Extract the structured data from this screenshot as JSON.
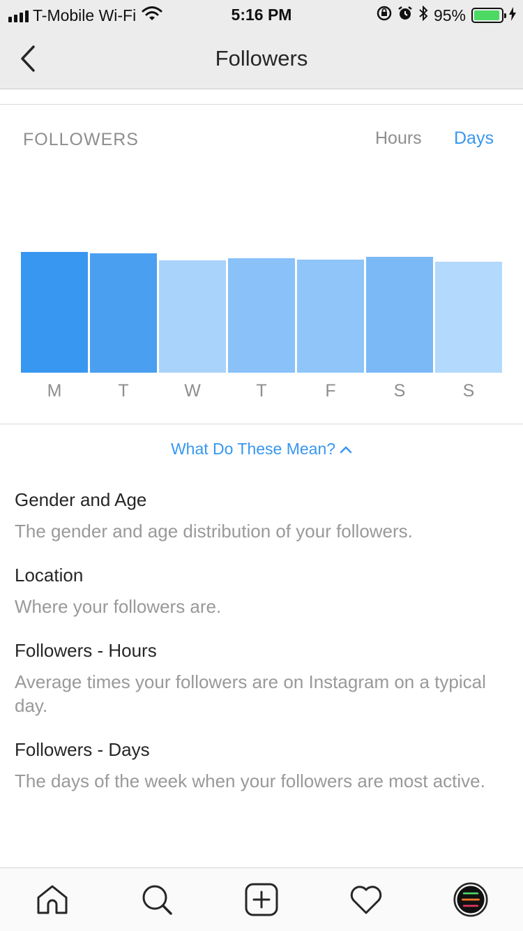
{
  "status_bar": {
    "carrier": "T-Mobile Wi-Fi",
    "time": "5:16 PM",
    "battery": "95%",
    "battery_level": 0.95
  },
  "nav": {
    "title": "Followers",
    "back_icon": "chevron-left-icon"
  },
  "card": {
    "title": "FOLLOWERS",
    "toggle_hours": "Hours",
    "toggle_days": "Days",
    "active_toggle": "Days"
  },
  "chart_data": {
    "type": "bar",
    "categories": [
      "M",
      "T",
      "W",
      "T",
      "F",
      "S",
      "S"
    ],
    "values": [
      100,
      99,
      93,
      95,
      94,
      96,
      92
    ],
    "ylim": [
      0,
      176
    ],
    "colors": [
      "#3897f0",
      "#4a9ff1",
      "#a9d3fb",
      "#89c1f8",
      "#8fc5f8",
      "#7bb9f6",
      "#b3d9fc"
    ]
  },
  "info": {
    "link_text": "What Do These Mean?",
    "items": [
      {
        "title": "Gender and Age",
        "desc": "The gender and age distribution of your followers."
      },
      {
        "title": "Location",
        "desc": "Where your followers are."
      },
      {
        "title": "Followers - Hours",
        "desc": "Average times your followers are on Instagram on a typical day."
      },
      {
        "title": "Followers - Days",
        "desc": "The days of the week when your followers are most active."
      }
    ]
  },
  "tabbar": {
    "icons": [
      "home-icon",
      "search-icon",
      "new-post-icon",
      "activity-heart-icon",
      "profile-avatar-icon"
    ]
  },
  "colors": {
    "accent": "#3897f0",
    "muted": "#8e8e8e",
    "battery": "#4cd964"
  }
}
